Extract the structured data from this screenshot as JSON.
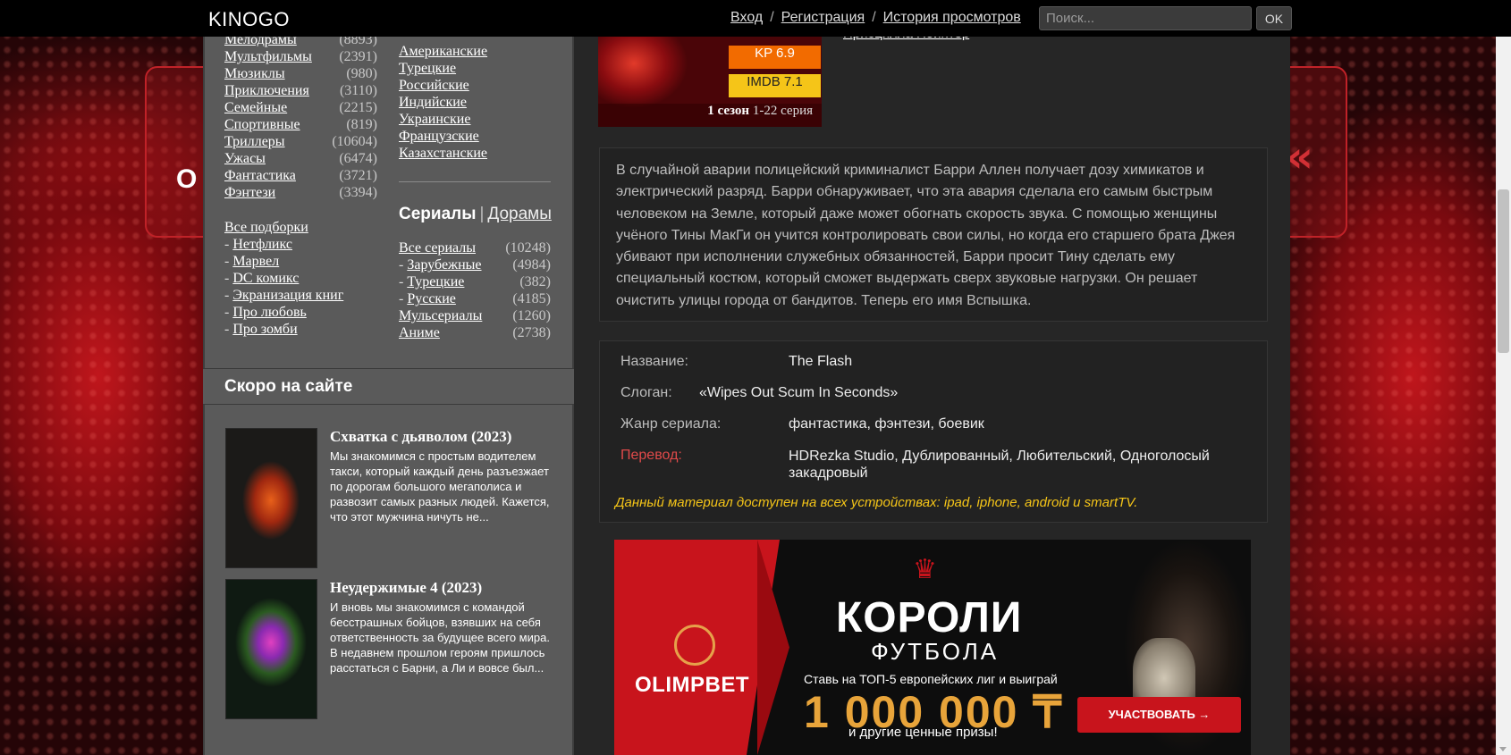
{
  "header": {
    "logo": "KINOGO",
    "login": "Вход",
    "register": "Регистрация",
    "history": "История просмотров",
    "search_placeholder": "Поиск...",
    "ok": "OK"
  },
  "sidebar": {
    "genres": [
      {
        "label": "Мелодрамы",
        "count": "(8893)"
      },
      {
        "label": "Мультфильмы",
        "count": "(2391)"
      },
      {
        "label": "Мюзиклы",
        "count": "(980)"
      },
      {
        "label": "Приключения",
        "count": "(3110)"
      },
      {
        "label": "Семейные",
        "count": "(2215)"
      },
      {
        "label": "Спортивные",
        "count": "(819)"
      },
      {
        "label": "Триллеры",
        "count": "(10604)"
      },
      {
        "label": "Ужасы",
        "count": "(6474)"
      },
      {
        "label": "Фантастика",
        "count": "(3721)"
      },
      {
        "label": "Фэнтези",
        "count": "(3394)"
      }
    ],
    "countries": [
      "Американские",
      "Турецкие",
      "Российские",
      "Индийские",
      "Украинские",
      "Французские",
      "Казахстанские"
    ],
    "collections_title": "Все подборки",
    "collections": [
      "Нетфликс",
      "Марвел",
      "DC комикс",
      "Экранизация книг",
      "Про любовь",
      "Про зомби"
    ],
    "serials_label": "Сериалы",
    "dramas_label": "Дорамы",
    "serials": [
      {
        "label": "Все сериалы",
        "count": "(10248)",
        "dash": false
      },
      {
        "label": "Зарубежные",
        "count": "(4984)",
        "dash": true
      },
      {
        "label": "Турецкие",
        "count": "(382)",
        "dash": true
      },
      {
        "label": "Русские",
        "count": "(4185)",
        "dash": true
      },
      {
        "label": "Мульсериалы",
        "count": "(1260)",
        "dash": false
      },
      {
        "label": "Аниме",
        "count": "(2738)",
        "dash": false
      }
    ],
    "dash": "-",
    "soon_title": "Скоро на сайте",
    "soon": [
      {
        "title": "Схватка с дьяволом (2023)",
        "desc": "Мы знакомимся с простым водителем такси, который каждый день разъезжает по дорогам большого мегаполиса и развозит самых разных людей. Кажется, что этот мужчина ничуть не..."
      },
      {
        "title": "Неудержимые 4 (2023)",
        "desc": "И вновь мы знакомимся с командой бесстрашных бойцов, взявших на себя ответственность за будущее всего мира. В недавнем прошлом героям пришлось расстаться с Барни, а Ли и вовсе был..."
      }
    ]
  },
  "movie": {
    "top_cut": "Присцилла Пойнтер",
    "kp": "KP 6.9",
    "imdb": "IMDB 7.1",
    "season": "1 сезон",
    "episodes": "1-22 серия",
    "description": "В случайной аварии полицейский криминалист Барри Аллен получает дозу химикатов и электрический разряд. Барри обнаруживает, что эта авария сделала его самым быстрым человеком на Земле, который даже может обогнать скорость звука. С помощью женщины учёного Тины МакГи он учится контролировать свои силы, но когда его старшего брата Джея убивают при исполнении служебных обязанностей, Барри просит Тину сделать ему специальный костюм, который сможет выдержать сверх звуковые нагрузки. Он решает очистить улицы города от бандитов. Теперь его имя Вспышка.",
    "name_label": "Название:",
    "name_value": "The Flash",
    "slogan_label": "Слоган:",
    "slogan_value": "«Wipes Out Scum In Seconds»",
    "genre_label": "Жанр сериала:",
    "genre_value": "фантастика, фэнтези, боевик",
    "translation_label": "Перевод:",
    "translation_value": "HDRezka Studio, Дублированный, Любительский, Одноголосый закадровый",
    "device_note": "Данный материал доступен на всех устройствах: ipad, iphone, android и smartTV."
  },
  "ad": {
    "brand": "OLIMPBET",
    "title1": "КОРОЛИ",
    "title2": "ФУТБОЛА",
    "sub": "Ставь на ТОП-5 европейских лиг и выиграй",
    "amount": "1 000 000 ₸",
    "prize": "и другие ценные призы!",
    "cta": "УЧАСТВОВАТЬ →"
  },
  "colors": {
    "topbar": "#000000",
    "sidebar": "#5a5a5a",
    "main": "#262626",
    "kp": "#f26b00",
    "imdb": "#f5c518",
    "accent_red": "#e04a4a"
  }
}
